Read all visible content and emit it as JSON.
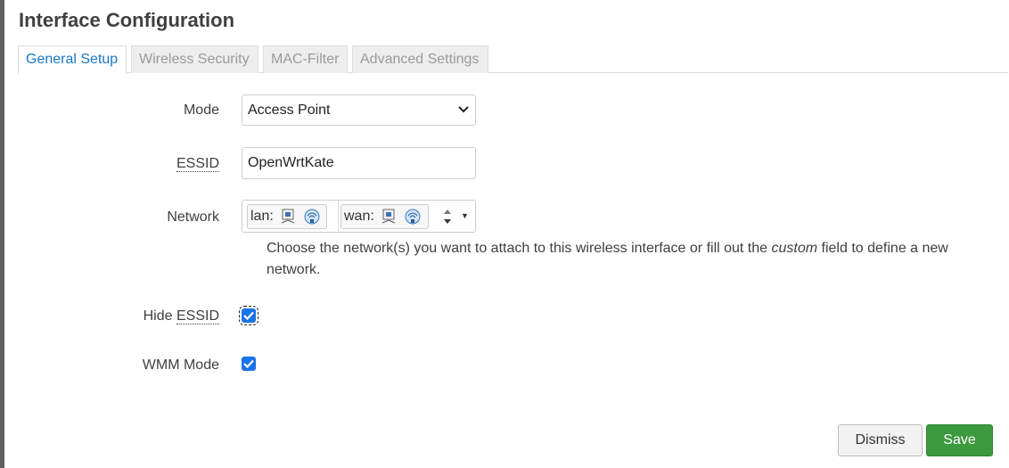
{
  "dialog": {
    "title": "Interface Configuration"
  },
  "tabs": [
    {
      "label": "General Setup",
      "active": true
    },
    {
      "label": "Wireless Security",
      "active": false
    },
    {
      "label": "MAC-Filter",
      "active": false
    },
    {
      "label": "Advanced Settings",
      "active": false
    }
  ],
  "fields": {
    "mode": {
      "label": "Mode",
      "value": "Access Point"
    },
    "essid": {
      "label": "ESSID",
      "value": "OpenWrtKate"
    },
    "network": {
      "label": "Network",
      "chips": [
        {
          "name": "lan:",
          "icons": [
            "ethernet-port-icon",
            "wireless-icon"
          ]
        },
        {
          "name": "wan:",
          "icons": [
            "ethernet-port-icon",
            "wireless-icon"
          ]
        }
      ],
      "help_before": "Choose the network(s) you want to attach to this wireless interface or fill out the",
      "help_em": "custom",
      "help_after": "field to define a new network."
    },
    "hide_essid": {
      "label_prefix": "Hide",
      "label_abbr": "ESSID",
      "checked": true
    },
    "wmm_mode": {
      "label": "WMM Mode",
      "checked": true
    }
  },
  "buttons": {
    "dismiss": "Dismiss",
    "save": "Save"
  },
  "colors": {
    "tab_active": "#1976c6",
    "checkbox": "#1a73e8",
    "save_button": "#3c9a3e"
  }
}
